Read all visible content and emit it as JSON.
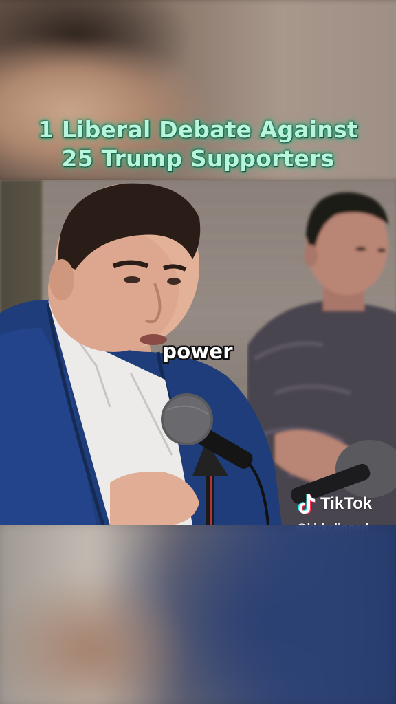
{
  "video": {
    "title_line1": "1 Liberal Debate Against",
    "title_line2": "25 Trump Supporters",
    "caption": "power"
  },
  "watermark": {
    "brand": "TikTok",
    "handle": "@kirkclipped",
    "logo_icon": "tiktok-note-icon"
  },
  "colors": {
    "title_text": "#b9f5dc",
    "title_glow": "#2fd39a",
    "caption_text": "#ffffff",
    "suit_blue": "#1f3d7a"
  }
}
